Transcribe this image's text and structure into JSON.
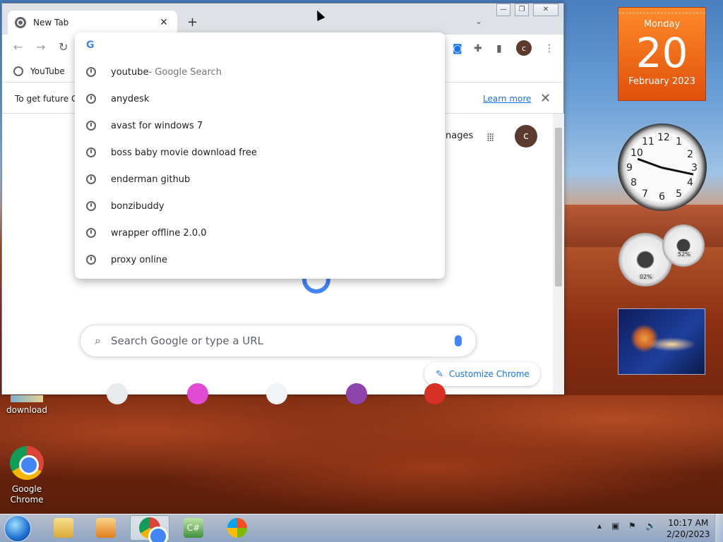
{
  "browser": {
    "tab_title": "New Tab",
    "new_tab_symbol": "+",
    "tab_close_symbol": "✕",
    "bookmark": "YouTube",
    "info_text": "To get future G",
    "learn_more": "Learn more",
    "info_close": "✕",
    "images_text": "nages",
    "avatar_letter": "c",
    "search_placeholder": "Search Google or type a URL",
    "customize_label": "Customize Chrome",
    "window_controls": [
      "—",
      "❐",
      "✕"
    ]
  },
  "omnibox": {
    "suggestions": [
      {
        "text": "youtube",
        "suffix": " - Google Search"
      },
      {
        "text": "anydesk",
        "suffix": ""
      },
      {
        "text": "avast for windows 7",
        "suffix": ""
      },
      {
        "text": "boss baby movie download free",
        "suffix": ""
      },
      {
        "text": "enderman github",
        "suffix": ""
      },
      {
        "text": "bonzibuddy",
        "suffix": ""
      },
      {
        "text": "wrapper offline 2.0.0",
        "suffix": ""
      },
      {
        "text": "proxy online",
        "suffix": ""
      }
    ]
  },
  "gadgets": {
    "calendar": {
      "day": "Monday",
      "date": "20",
      "month": "February 2023"
    },
    "clock_numbers": [
      "12",
      "1",
      "2",
      "3",
      "4",
      "5",
      "6",
      "7",
      "8",
      "9",
      "10",
      "11"
    ],
    "meter_cpu": "02%",
    "meter_mem": "52%"
  },
  "desktop": {
    "icons": [
      {
        "label": "download"
      },
      {
        "label": "Google Chrome"
      }
    ]
  },
  "taskbar": {
    "time": "10:17 AM",
    "date": "2/20/2023"
  },
  "colors": {
    "accent": "#1a73e8",
    "calendar": "#f36f15",
    "avatar": "#5c3a2e"
  }
}
